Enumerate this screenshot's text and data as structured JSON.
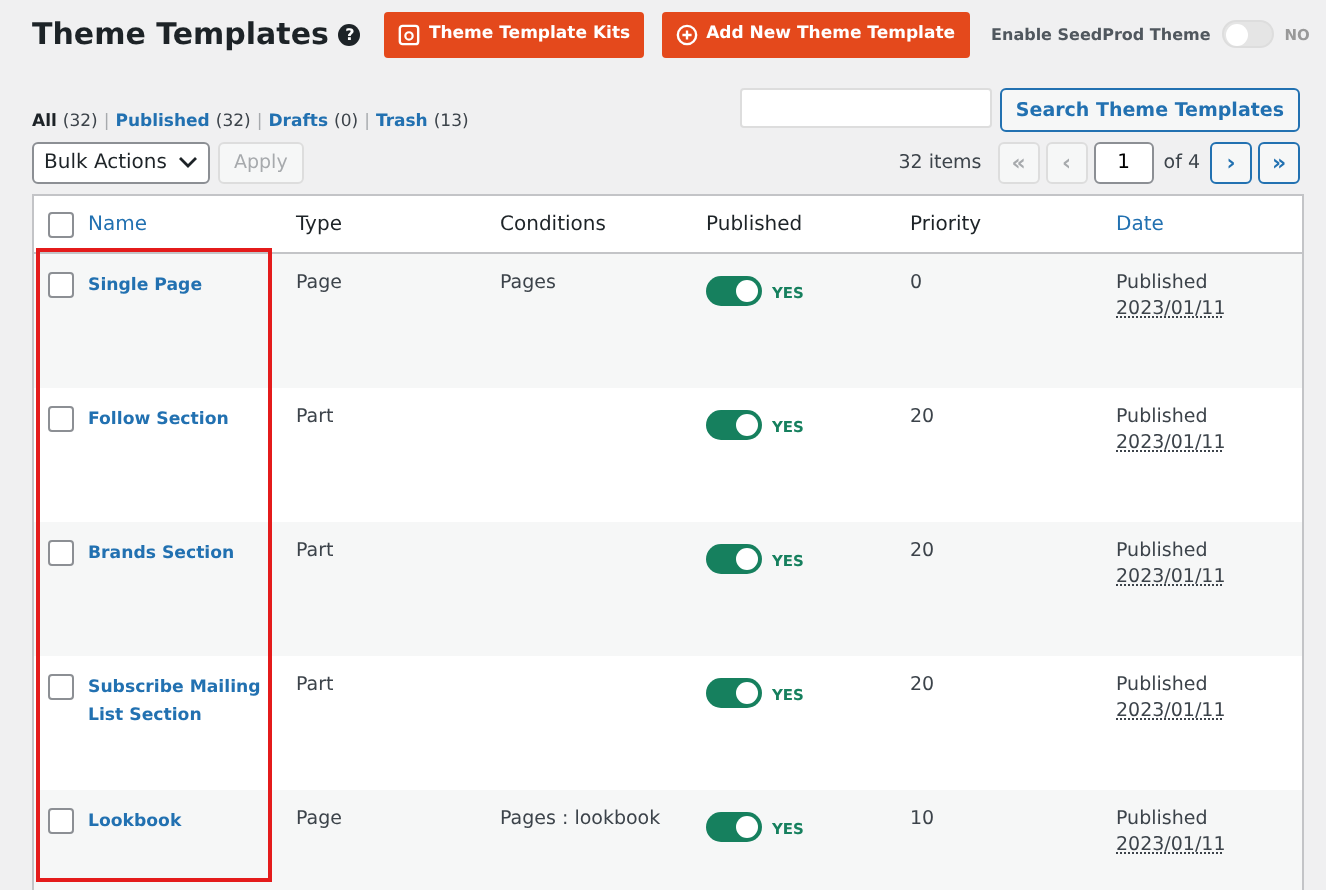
{
  "header": {
    "title": "Theme Templates",
    "help": "?",
    "buttons": [
      {
        "label": "Theme Template Kits",
        "kind": "kits"
      },
      {
        "label": "Add New Theme Template",
        "kind": "add"
      }
    ],
    "theme_toggle": {
      "label": "Enable SeedProd Theme",
      "on": false,
      "state_text": "NO"
    }
  },
  "filter_separator": "|",
  "filters": [
    {
      "label": "All",
      "count": "(32)",
      "selected": true
    },
    {
      "label": "Published",
      "count": "(32)",
      "selected": false
    },
    {
      "label": "Drafts",
      "count": "(0)",
      "selected": false
    },
    {
      "label": "Trash",
      "count": "(13)",
      "selected": false
    }
  ],
  "search": {
    "button": "Search Theme Templates"
  },
  "bulk": {
    "value": "Bulk Actions",
    "apply": "Apply"
  },
  "pagination": {
    "items": "32 items",
    "first": "«",
    "prev": "‹",
    "page": "1",
    "of": "of 4",
    "next": "›",
    "last": "»"
  },
  "table": {
    "select_all_checked": false,
    "columns": [
      {
        "label": "Name",
        "sortable": true
      },
      {
        "label": "Type",
        "sortable": false
      },
      {
        "label": "Conditions",
        "sortable": false
      },
      {
        "label": "Published",
        "sortable": false
      },
      {
        "label": "Priority",
        "sortable": false
      },
      {
        "label": "Date",
        "sortable": true
      }
    ],
    "rows": [
      {
        "name": "Single Page",
        "type": "Page",
        "conditions": "Pages",
        "published": true,
        "published_text": "YES",
        "priority": "0",
        "status": "Published",
        "date": "2023/01/11",
        "checked": false
      },
      {
        "name": "Follow Section",
        "type": "Part",
        "published": true,
        "published_text": "YES",
        "priority": "20",
        "status": "Published",
        "date": "2023/01/11",
        "checked": false
      },
      {
        "name": "Brands Section",
        "type": "Part",
        "published": true,
        "published_text": "YES",
        "priority": "20",
        "status": "Published",
        "date": "2023/01/11",
        "checked": false
      },
      {
        "name": "Subscribe Mailing List Section",
        "type": "Part",
        "published": true,
        "published_text": "YES",
        "priority": "20",
        "status": "Published",
        "date": "2023/01/11",
        "checked": false
      },
      {
        "name": "Lookbook",
        "type": "Page",
        "conditions": "Pages : lookbook",
        "published": true,
        "published_text": "YES",
        "priority": "10",
        "status": "Published",
        "date": "2023/01/11",
        "checked": false
      }
    ]
  }
}
